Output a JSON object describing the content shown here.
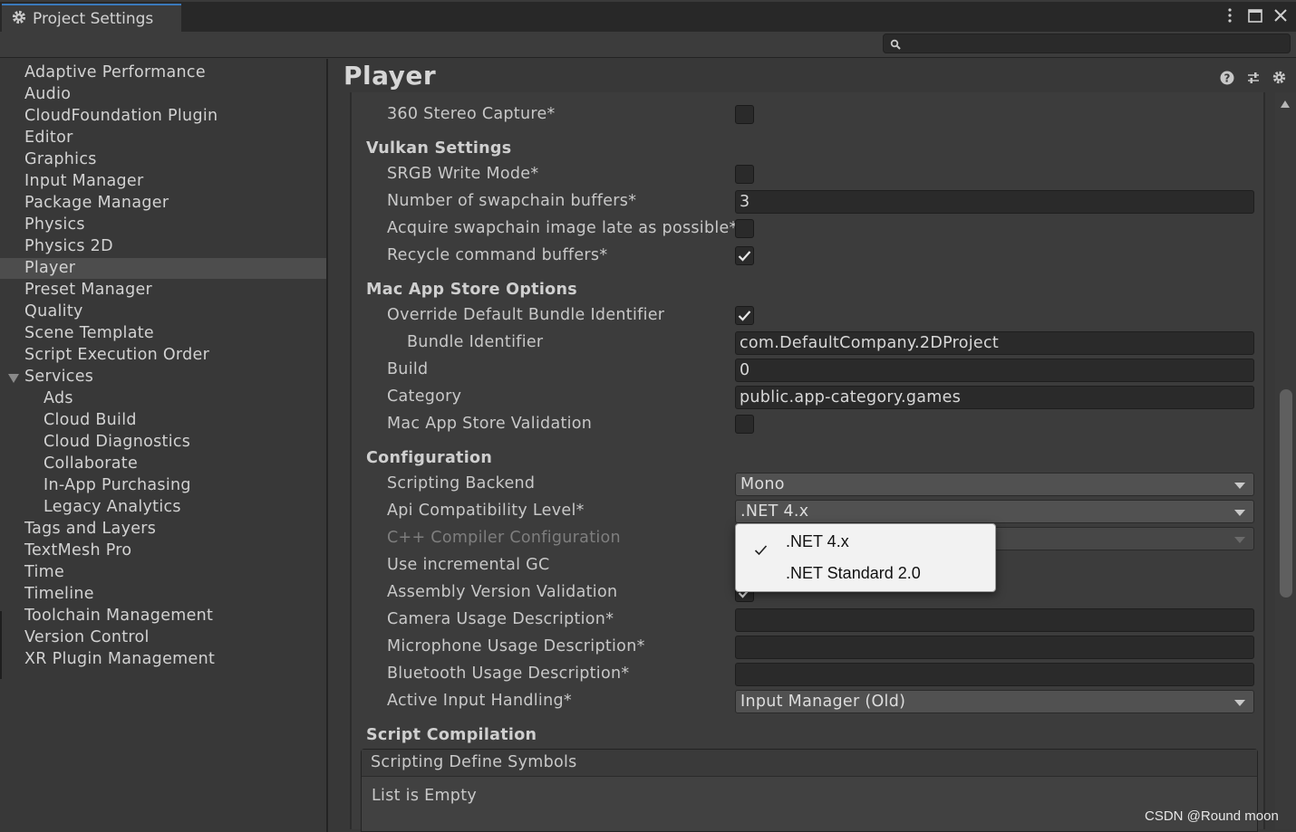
{
  "window": {
    "tab_title": "Project Settings",
    "search_placeholder": ""
  },
  "sidebar": {
    "items": [
      "Adaptive Performance",
      "Audio",
      "CloudFoundation Plugin",
      "Editor",
      "Graphics",
      "Input Manager",
      "Package Manager",
      "Physics",
      "Physics 2D",
      "Player",
      "Preset Manager",
      "Quality",
      "Scene Template",
      "Script Execution Order",
      "Services",
      "Ads",
      "Cloud Build",
      "Cloud Diagnostics",
      "Collaborate",
      "In-App Purchasing",
      "Legacy Analytics",
      "Tags and Layers",
      "TextMesh Pro",
      "Time",
      "Timeline",
      "Toolchain Management",
      "Version Control",
      "XR Plugin Management"
    ],
    "selected": "Player"
  },
  "main": {
    "title": "Player",
    "stereo_capture_label": "360 Stereo Capture*",
    "vulkan": {
      "header": "Vulkan Settings",
      "srgb_label": "SRGB Write Mode*",
      "swapchain_label": "Number of swapchain buffers*",
      "swapchain_value": "3",
      "acquire_label": "Acquire swapchain image late as possible*",
      "recycle_label": "Recycle command buffers*"
    },
    "mac": {
      "header": "Mac App Store Options",
      "override_label": "Override Default Bundle Identifier",
      "bundle_label": "Bundle Identifier",
      "bundle_value": "com.DefaultCompany.2DProject",
      "build_label": "Build",
      "build_value": "0",
      "category_label": "Category",
      "category_value": "public.app-category.games",
      "validation_label": "Mac App Store Validation"
    },
    "config": {
      "header": "Configuration",
      "backend_label": "Scripting Backend",
      "backend_value": "Mono",
      "api_label": "Api Compatibility Level*",
      "api_value": ".NET 4.x",
      "cpp_label": "C++ Compiler Configuration",
      "incgc_label": "Use incremental GC",
      "assembly_label": "Assembly Version Validation",
      "camera_label": "Camera Usage Description*",
      "mic_label": "Microphone Usage Description*",
      "bt_label": "Bluetooth Usage Description*",
      "input_label": "Active Input Handling*",
      "input_value": "Input Manager (Old)"
    },
    "compilation": {
      "header": "Script Compilation",
      "symbols_label": "Scripting Define Symbols",
      "empty_text": "List is Empty"
    }
  },
  "popup": {
    "options": [
      ".NET 4.x",
      ".NET Standard 2.0"
    ],
    "selected": ".NET 4.x"
  },
  "watermark": "CSDN @Round moon",
  "colors": {
    "accent": "#3a79bb",
    "background": "#383838",
    "popup": "#f2f2f2"
  }
}
